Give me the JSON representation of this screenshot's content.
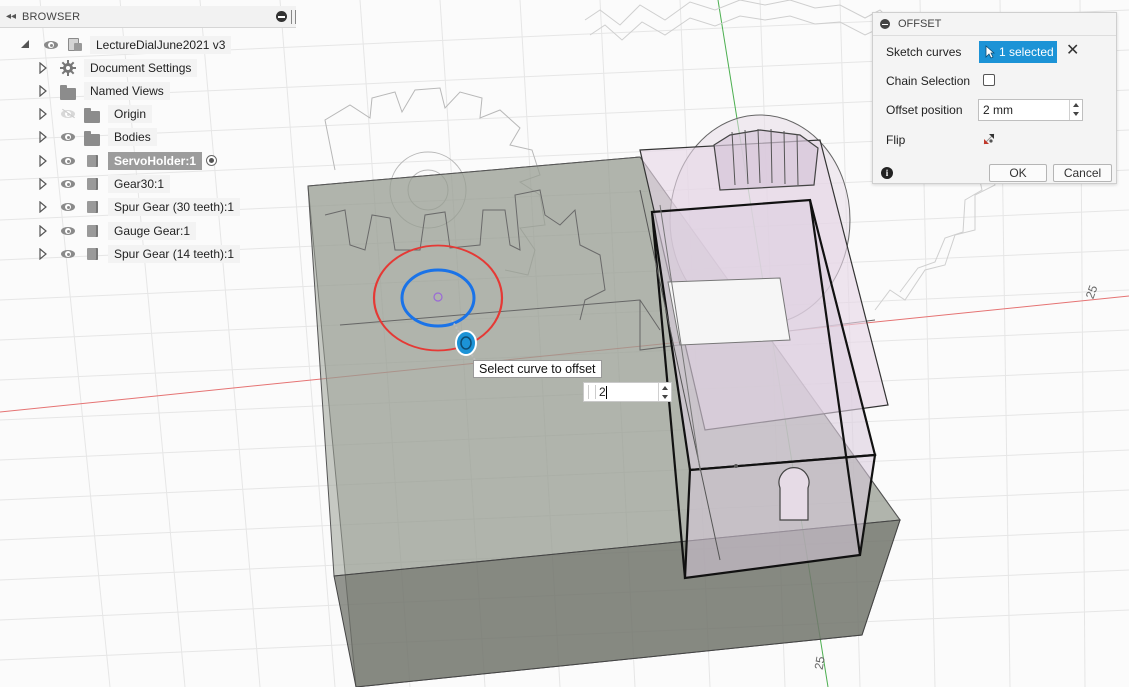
{
  "browser": {
    "title": "BROWSER",
    "root": "LectureDialJune2021 v3",
    "items": [
      {
        "label": "Document Settings",
        "icon": "gear-icon",
        "visible": null
      },
      {
        "label": "Named Views",
        "icon": "folder-icon",
        "visible": null
      },
      {
        "label": "Origin",
        "icon": "folder-icon",
        "visible": false
      },
      {
        "label": "Bodies",
        "icon": "folder-icon",
        "visible": true
      },
      {
        "label": "ServoHolder:1",
        "icon": "component-icon",
        "visible": true,
        "active": true
      },
      {
        "label": "Gear30:1",
        "icon": "component-icon",
        "visible": true
      },
      {
        "label": "Spur Gear (30 teeth):1",
        "icon": "component-icon",
        "visible": true
      },
      {
        "label": "Gauge Gear:1",
        "icon": "component-icon",
        "visible": true
      },
      {
        "label": "Spur Gear (14 teeth):1",
        "icon": "component-icon",
        "visible": true
      }
    ]
  },
  "offset": {
    "title": "OFFSET",
    "sketch_curves_label": "Sketch curves",
    "selected_label": "1 selected",
    "chain_selection_label": "Chain Selection",
    "chain_selection_checked": false,
    "offset_position_label": "Offset position",
    "offset_position_value": "2 mm",
    "flip_label": "Flip",
    "ok_label": "OK",
    "cancel_label": "Cancel"
  },
  "canvas": {
    "tooltip": "Select curve to offset",
    "input_value": "2",
    "axis_label_right": "25",
    "axis_label_bottom": "25",
    "colors": {
      "selected_curve": "#1a73e8",
      "preview_curve": "#e53935",
      "x_axis": "#e57373",
      "y_axis": "#4caf50",
      "accent": "#1c93d6"
    }
  }
}
